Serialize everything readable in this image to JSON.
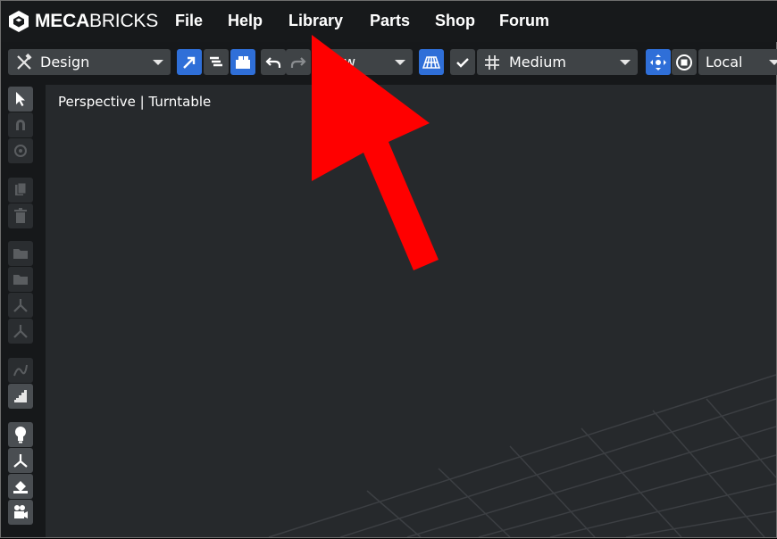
{
  "app": {
    "logo_bold": "MECA",
    "logo_light": "BRICKS"
  },
  "menu": {
    "items": [
      "File",
      "Help",
      "Library",
      "Parts",
      "Shop",
      "Forum"
    ]
  },
  "toolbar": {
    "mode_dropdown": {
      "label": "Design",
      "icon": "hammer-wrench-icon"
    },
    "partial_dropdown": {
      "label": "w"
    },
    "quality_dropdown": {
      "label": "Medium"
    },
    "space_dropdown": {
      "label": "Local"
    }
  },
  "viewport": {
    "label": "Perspective | Turntable"
  },
  "colors": {
    "accent_blue": "#2f6fd8",
    "annotation_red": "#ff0000",
    "viewport_bg": "#26292c"
  }
}
